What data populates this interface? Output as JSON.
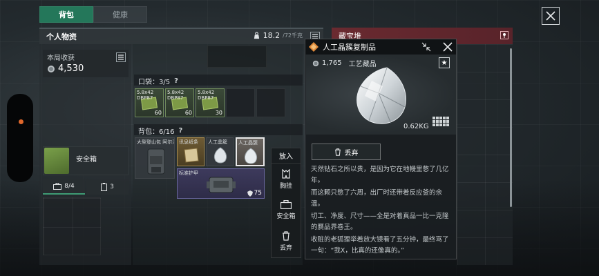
{
  "tabs": [
    {
      "label": "背包",
      "active": true
    },
    {
      "label": "健康",
      "active": false
    }
  ],
  "personal": {
    "title": "个人物资",
    "weight_current": "18.2",
    "weight_max": "/72千克"
  },
  "loot": {
    "label": "本局收获",
    "value": "4,530"
  },
  "safebox": {
    "label": "安全箱",
    "caps": [
      {
        "icon": "toolbox-icon",
        "value": "8/4"
      },
      {
        "icon": "battery-icon",
        "value": "3"
      }
    ]
  },
  "pocket": {
    "title": "口袋：3/5",
    "help": "?",
    "items": [
      {
        "label": "5.8x42 DBP87",
        "count": "60"
      },
      {
        "label": "5.8x42 DBP87",
        "count": "60"
      },
      {
        "label": "5.8x42 DBP87",
        "count": "30"
      }
    ]
  },
  "backpack": {
    "title": "背包：6/16",
    "help": "?",
    "items": {
      "bag": "大型登山包 阿尔法",
      "doc": "讯息纸条",
      "gem1": "人工晶簇",
      "gem2": "人工晶簇",
      "armor": "标准护甲",
      "armor_value": "75"
    }
  },
  "actions": {
    "title": "放入",
    "items": [
      {
        "label": "胸挂",
        "icon": "vest-icon"
      },
      {
        "label": "安全箱",
        "icon": "toolbox-icon"
      },
      {
        "label": "丢弃",
        "icon": "trash-icon"
      }
    ]
  },
  "storage": {
    "title": "藏宝堆"
  },
  "detail": {
    "title": "人工晶簇复制品",
    "price": "1,765",
    "rarity": "工艺藏品",
    "weight": "0.62KG",
    "discard_label": "丢弃",
    "description": [
      "天然钻石之所以贵，是因为它在地幔里憋了几亿年。",
      "而这颗只憋了六周，出厂时还带着反应釜的余温。",
      "切工、净度、尺寸——全是对着真品一比一克隆的赝品界卷王。",
      "收赃的老狐狸举着放大镜看了五分钟，最终骂了一句：“我X，比真的还像真的。”"
    ]
  },
  "colors": {
    "tab_active": "#24775a",
    "storage_header": "#6a2a30",
    "ammo_green": "#7d9a46",
    "accent_orange": "#e0682c"
  }
}
